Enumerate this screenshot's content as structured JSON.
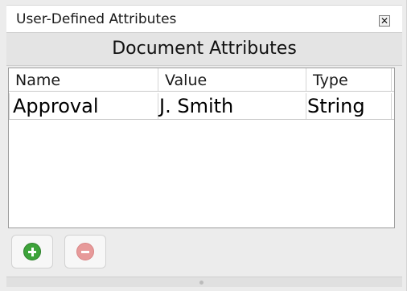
{
  "window": {
    "title": "User-Defined Attributes",
    "close_icon": "close-icon"
  },
  "panel": {
    "header": "Document Attributes"
  },
  "table": {
    "columns": [
      "Name",
      "Value",
      "Type"
    ],
    "rows": [
      {
        "name": "Approval",
        "value": "J. Smith",
        "type": "String"
      }
    ]
  },
  "toolbar": {
    "add_icon": "add-circle-icon",
    "remove_icon": "remove-circle-icon",
    "add_color": "#3da33a",
    "remove_color": "#e79a9a"
  }
}
